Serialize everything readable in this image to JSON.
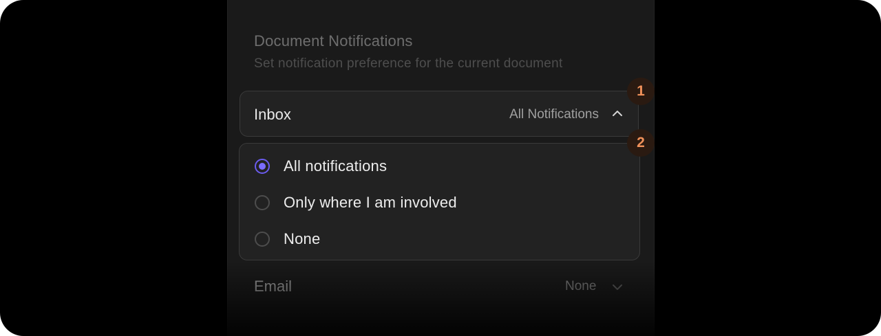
{
  "section": {
    "title": "Document Notifications",
    "subtitle": "Set notification preference for the current document"
  },
  "inbox": {
    "label": "Inbox",
    "value": "All Notifications",
    "expanded": true
  },
  "options": [
    {
      "label": "All notifications",
      "selected": true
    },
    {
      "label": "Only where I am involved",
      "selected": false
    },
    {
      "label": "None",
      "selected": false
    }
  ],
  "email": {
    "label": "Email",
    "value": "None"
  },
  "badges": [
    "1",
    "2"
  ],
  "icons": {
    "inbox_toggle": "chevron-up-icon",
    "email_toggle": "chevron-down-icon"
  },
  "colors": {
    "accent": "#7b6cff",
    "badge_text": "#f0915a",
    "badge_bg": "#2a1a11"
  }
}
